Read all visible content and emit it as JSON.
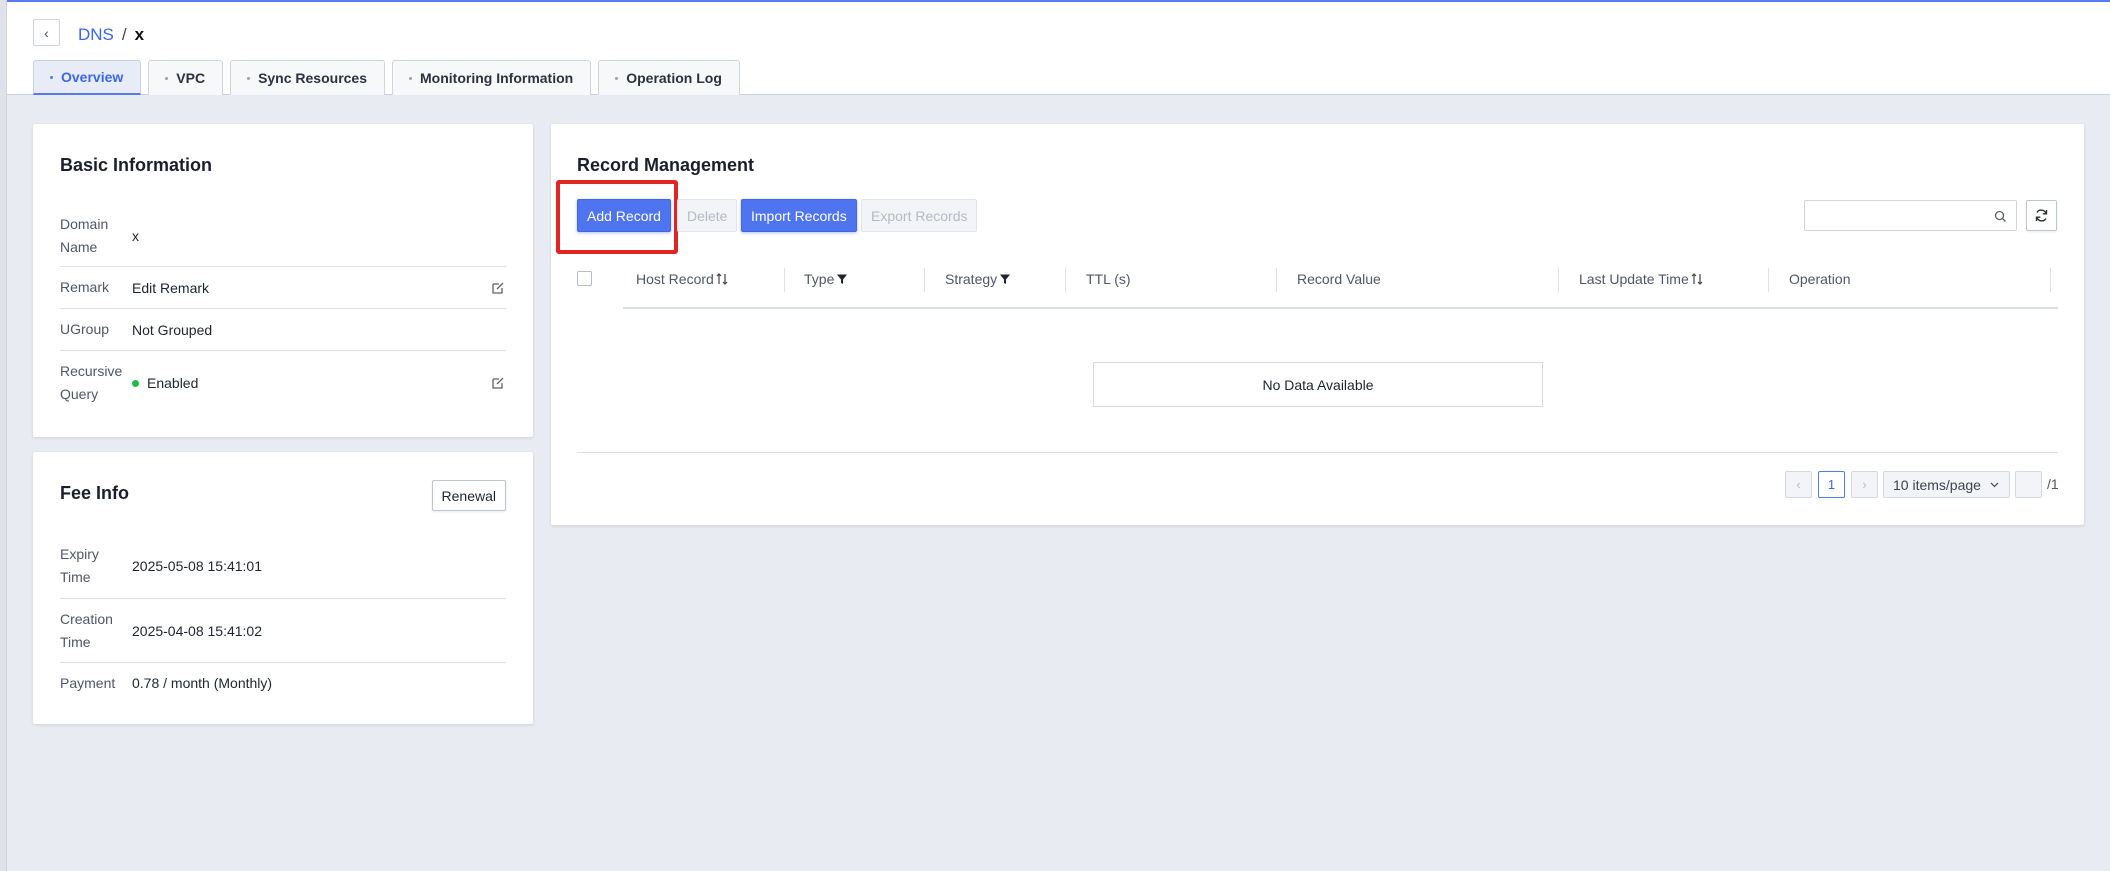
{
  "breadcrumb": {
    "parent": "DNS",
    "separator": "/",
    "current": "x"
  },
  "tabs": [
    {
      "label": "Overview",
      "active": true
    },
    {
      "label": "VPC",
      "active": false
    },
    {
      "label": "Sync Resources",
      "active": false
    },
    {
      "label": "Monitoring Information",
      "active": false
    },
    {
      "label": "Operation Log",
      "active": false
    }
  ],
  "basic_info": {
    "title": "Basic Information",
    "rows": [
      {
        "label": "Domain Name",
        "value": "x"
      },
      {
        "label": "Remark",
        "value": "Edit Remark"
      },
      {
        "label": "UGroup",
        "value": "Not Grouped"
      },
      {
        "label": "Recursive Query",
        "value": "Enabled"
      }
    ]
  },
  "fee_info": {
    "title": "Fee Info",
    "renewal_label": "Renewal",
    "rows": [
      {
        "label": "Expiry Time",
        "value": "2025-05-08 15:41:01"
      },
      {
        "label": "Creation Time",
        "value": "2025-04-08 15:41:02"
      },
      {
        "label": "Payment",
        "value": "0.78 / month (Monthly)"
      }
    ]
  },
  "records": {
    "title": "Record Management",
    "buttons": {
      "add": "Add Record",
      "delete": "Delete",
      "import": "Import Records",
      "export": "Export Records"
    },
    "search_placeholder": "",
    "columns": [
      "Host Record",
      "Type",
      "Strategy",
      "TTL (s)",
      "Record Value",
      "Last Update Time",
      "Operation"
    ],
    "empty_text": "No Data Available",
    "pagination": {
      "current_page": "1",
      "page_size": "10 items/page",
      "total_pages": "/1"
    }
  },
  "colors": {
    "accent": "#4f74ef",
    "highlight": "#e32424",
    "status_enabled": "#1dbb4a"
  }
}
